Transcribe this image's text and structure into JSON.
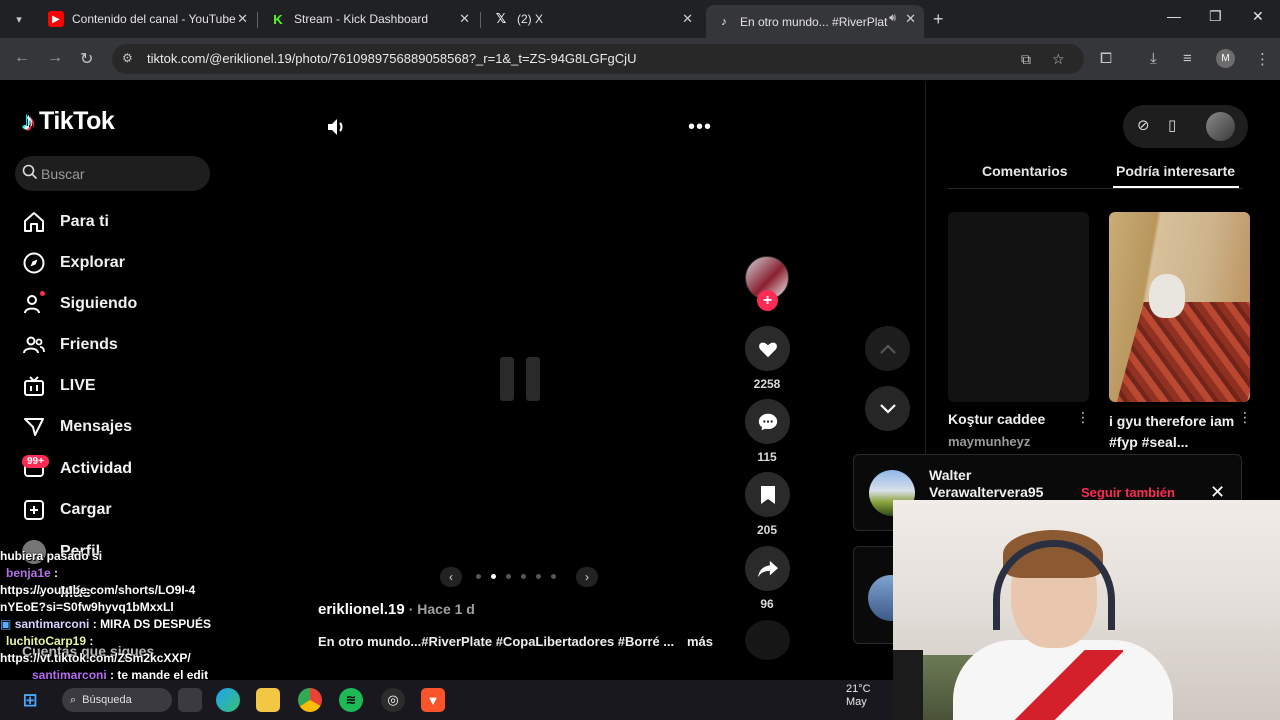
{
  "browser": {
    "tabs": [
      {
        "title": "Contenido del canal - YouTube",
        "icon": "youtube-icon",
        "color": "#ff0000"
      },
      {
        "title": "Stream - Kick Dashboard",
        "icon": "kick-icon",
        "color": "#53fc18"
      },
      {
        "title": "(2) X",
        "icon": "x-icon",
        "color": "#ffffff"
      },
      {
        "title": "En otro mundo... #RiverPlat",
        "icon": "tiktok-icon",
        "color": "#ffffff",
        "active": true
      }
    ],
    "url": "tiktok.com/@eriklionel.19/photo/7610989756889058568?_r=1&_t=ZS-94G8LGFgCjU",
    "profile_initial": "M"
  },
  "tiktok": {
    "logo": "TikTok",
    "search_placeholder": "Buscar",
    "nav": [
      {
        "label": "Para ti",
        "icon": "home-icon"
      },
      {
        "label": "Explorar",
        "icon": "compass-icon"
      },
      {
        "label": "Siguiendo",
        "icon": "following-icon"
      },
      {
        "label": "Friends",
        "icon": "friends-icon"
      },
      {
        "label": "LIVE",
        "icon": "live-icon"
      },
      {
        "label": "Mensajes",
        "icon": "messages-icon"
      },
      {
        "label": "Actividad",
        "icon": "activity-icon",
        "badge": "99+"
      },
      {
        "label": "Cargar",
        "icon": "upload-icon"
      },
      {
        "label": "Perfil",
        "icon": "profile-icon"
      },
      {
        "label": "Más",
        "icon": "more-icon"
      }
    ],
    "following_accounts_label": "Cuentas que sigues",
    "post": {
      "author": "eriklionel.19",
      "time": "· Hace 1 d",
      "caption": "En otro mundo...#RiverPlate #CopaLibertadores #Borré ...",
      "more": "más",
      "likes": "2258",
      "comments": "115",
      "saves": "205",
      "shares": "96",
      "slide_count": 6,
      "current_slide": 2
    },
    "right_panel": {
      "tabs": [
        "Comentarios",
        "Podría interesarte"
      ],
      "active_tab": 1,
      "videos": [
        {
          "title": "Koştur caddee",
          "author": "maymunheyz"
        },
        {
          "title": "i gyu therefore iam #fyp #seal...",
          "author": ""
        }
      ],
      "suggested": {
        "name": "Walter Verawaltervera95",
        "follow": "Seguir también"
      }
    }
  },
  "chat": [
    {
      "user": "",
      "text": "hubiera pasado si"
    },
    {
      "user": "benja1e",
      "text": ":"
    },
    {
      "user": "",
      "text": "https://youtube.com/shorts/LO9I-4nYEoE?si=S0fw9hyvq1bMxxLl"
    },
    {
      "user": "santimarconi",
      "text": ": MIRA DS DESPUÉS"
    },
    {
      "user": "luchitoCarp19",
      "text": ":"
    },
    {
      "user": "",
      "text": "https://vt.tiktok.com/ZSm2kcXXP/"
    },
    {
      "user": "santimarconi",
      "text": ": te mande el edit"
    }
  ],
  "taskbar": {
    "search_label": "Búsqueda",
    "weather_temp": "21°C",
    "weather_label": "May"
  }
}
